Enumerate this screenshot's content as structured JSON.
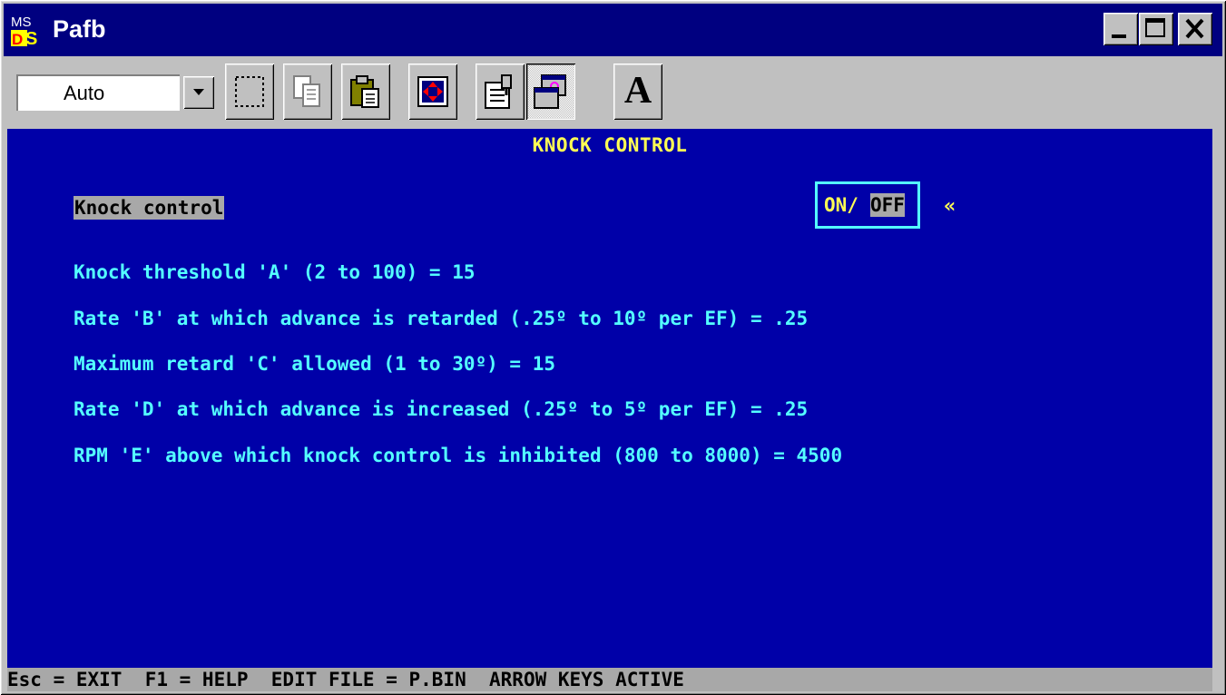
{
  "window": {
    "title": "Pafb",
    "app_icon_text": "MS-DOS"
  },
  "toolbar": {
    "font_size_value": "Auto",
    "buttons": [
      {
        "name": "mark-button",
        "icon": "mark-icon"
      },
      {
        "name": "copy-button",
        "icon": "copy-icon"
      },
      {
        "name": "paste-button",
        "icon": "paste-icon"
      },
      {
        "name": "full-screen-button",
        "icon": "full-screen-icon"
      },
      {
        "name": "properties-button",
        "icon": "properties-icon"
      },
      {
        "name": "background-button",
        "icon": "background-icon",
        "pressed": true
      },
      {
        "name": "font-button",
        "icon": "font-icon",
        "label": "A"
      }
    ]
  },
  "console": {
    "title": "KNOCK CONTROL",
    "knock_control_label": "Knock control",
    "on_label": "ON/",
    "off_label": "OFF",
    "selection_marker": "«",
    "params": [
      {
        "label": "Knock threshold 'A' (2 to 100) = ",
        "value": "15"
      },
      {
        "label": "Rate 'B' at which advance is retarded (.25º to 10º per EF) = ",
        "value": ".25"
      },
      {
        "label": "Maximum retard 'C' allowed (1 to 30º) = ",
        "value": "15"
      },
      {
        "label": "Rate 'D' at which advance is increased (.25º to 5º per EF) = ",
        "value": ".25"
      },
      {
        "label": "RPM 'E' above which knock control is inhibited (800 to 8000) = ",
        "value": "4500"
      }
    ],
    "status_bar": "Esc = EXIT  F1 = HELP  EDIT FILE = P.BIN  ARROW KEYS ACTIVE"
  },
  "colors": {
    "console_bg": "#0000a8",
    "cyan": "#54ffff",
    "yellow": "#ffff54",
    "highlight": "#a8a8a8",
    "titlebar": "#000080"
  }
}
